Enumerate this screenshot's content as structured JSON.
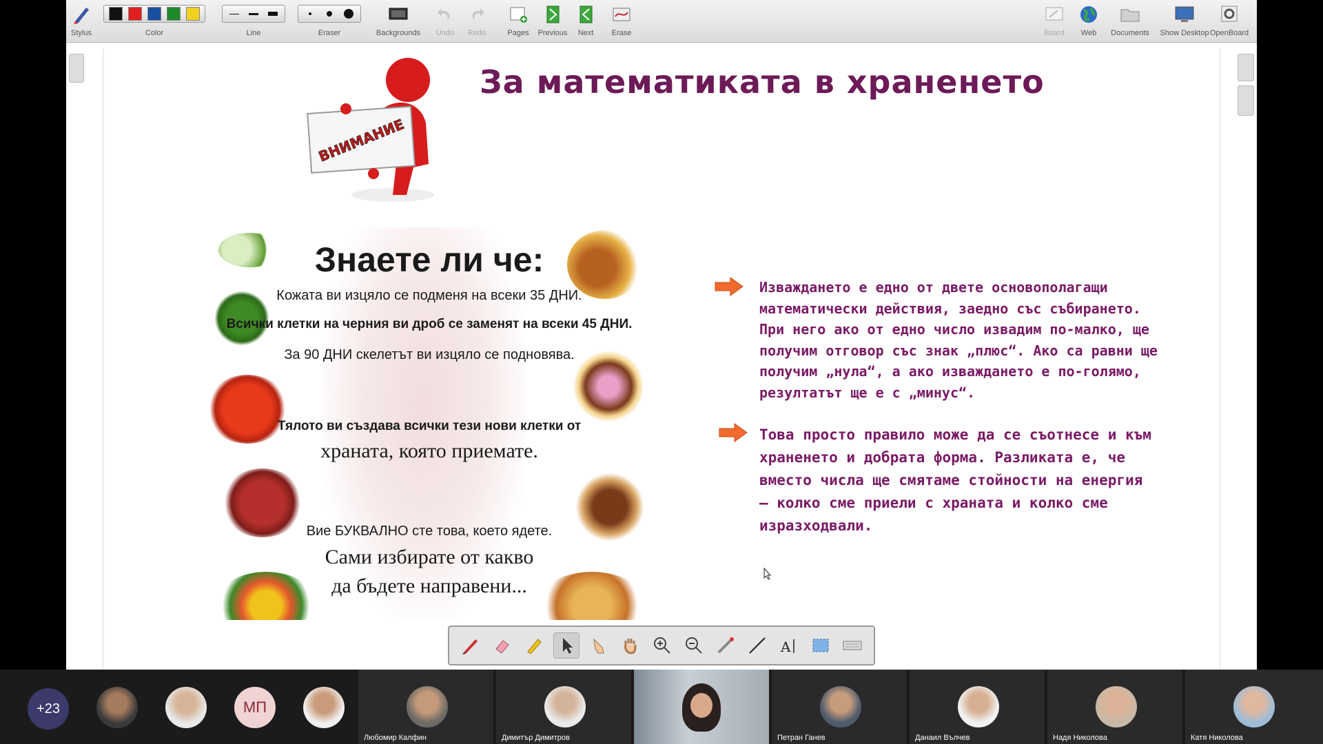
{
  "toolbar": {
    "stylus": "Stylus",
    "color": "Color",
    "line": "Line",
    "eraser": "Eraser",
    "backgrounds": "Backgrounds",
    "undo": "Undo",
    "redo": "Redo",
    "pages": "Pages",
    "previous": "Previous",
    "next": "Next",
    "erase": "Erase",
    "board": "Board",
    "web": "Web",
    "documents": "Documents",
    "show_desktop": "Show Desktop",
    "openboard": "OpenBoard",
    "colors": [
      "#111111",
      "#e02020",
      "#1a4fa0",
      "#1f8a2a",
      "#f0d020"
    ]
  },
  "slide": {
    "title": "За математиката в храненето",
    "attention_sign": "ВНИМАНИЕ",
    "facts": {
      "title": "Знаете ли че:",
      "line1": "Кожата ви изцяло се подменя на всеки 35 ДНИ.",
      "line2": "Всички клетки на черния ви дроб се заменят на всеки 45 ДНИ.",
      "line3": "За 90 ДНИ скелетът ви изцяло се подновява.",
      "line4": "Тялото ви създава всички тези нови клетки от",
      "line5": "храната, която приемате.",
      "line6": "Вие БУКВАЛНО сте това, което ядете.",
      "line7": "Сами избирате от какво",
      "line8": "да бъдете направени..."
    },
    "para1": "Изваждането е едно от двете основополагащи математически действия, заедно със събирането. При него ако от едно число извадим по-малко, ще получим отговор със знак „плюс“. Ако са равни ще получим „нула“, а ако изваждането е по-голямо, резултатът ще е с „минус“.",
    "para2": "Това просто правило може да се съотнесе и към храненето и добрата форма. Разликата е, че вместо числа ще смятаме стойности на енергия – колко сме приели с храната и колко сме изразходвали."
  },
  "participants": {
    "more_count": "+23",
    "initials": "МП",
    "tiles": [
      "Любомир Калфин",
      "Димитър Димитров",
      "",
      "Петран Ганев",
      "Данаил Вълчев",
      "Надя Николова",
      "Катя Николова"
    ]
  }
}
